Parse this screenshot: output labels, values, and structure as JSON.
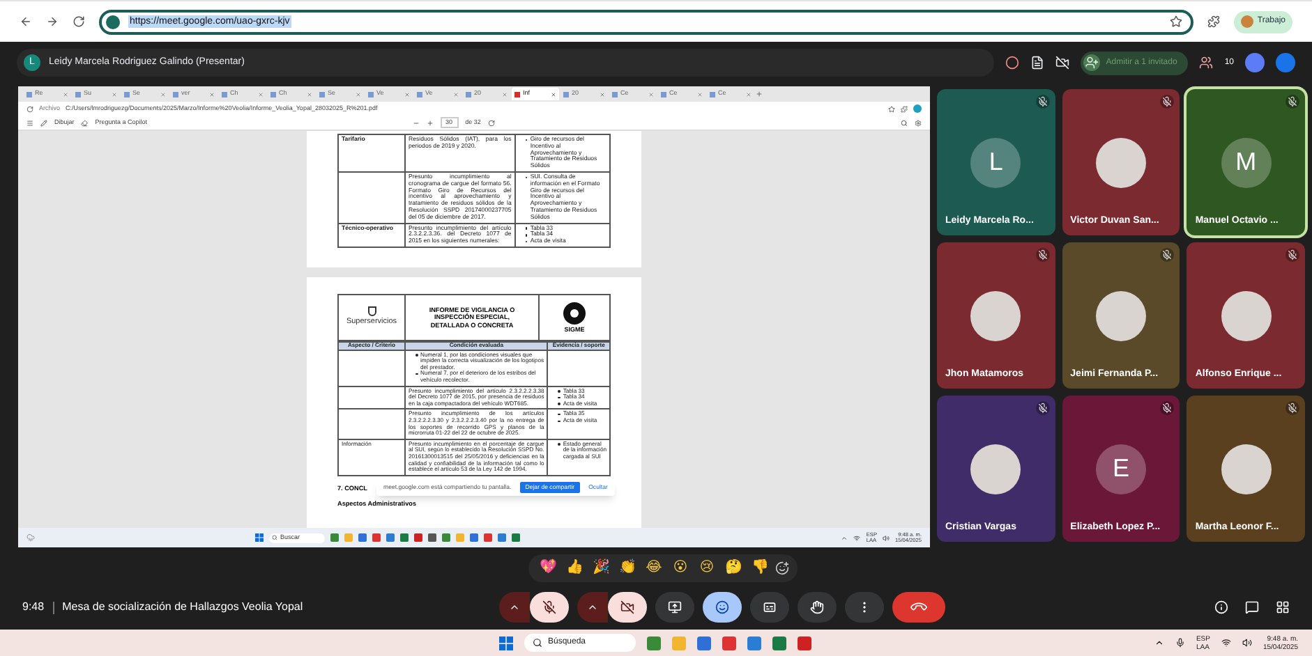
{
  "browser": {
    "url": "https://meet.google.com/uao-gxrc-kjv",
    "profile": "Trabajo"
  },
  "meet_header": {
    "presenter_initial": "L",
    "presenter": "Leidy Marcela Rodriguez Galindo (Presentar)",
    "admit_button": "Admitir a 1 invitado",
    "participant_count": "10"
  },
  "shared_screen": {
    "tabs": [
      {
        "label": "Re",
        "selected": false
      },
      {
        "label": "Su",
        "selected": false
      },
      {
        "label": "Se",
        "selected": false
      },
      {
        "label": "ver",
        "selected": false
      },
      {
        "label": "Ch",
        "selected": false
      },
      {
        "label": "Ch",
        "selected": false
      },
      {
        "label": "Se",
        "selected": false
      },
      {
        "label": "Ve",
        "selected": false
      },
      {
        "label": "Ve",
        "selected": false
      },
      {
        "label": "20",
        "selected": false
      },
      {
        "label": "Inf",
        "selected": true
      },
      {
        "label": "20",
        "selected": false
      },
      {
        "label": "Ce",
        "selected": false
      },
      {
        "label": "Ce",
        "selected": false
      },
      {
        "label": "Ce",
        "selected": false
      }
    ],
    "file_label": "Archivo",
    "path": "C:/Users/lmrodriguezg/Documents/2025/Marzo/Informe%20Veolia/Informe_Veolia_Yopal_28032025_R%201.pdf",
    "toolbar": {
      "draw": "Dibujar",
      "copilot": "Pregunta a Copilot",
      "page": "30",
      "page_total": "de 32"
    },
    "page_one_rows": [
      {
        "aspect": "Tarifario",
        "condition": "Residuos Sólidos (IAT), para los periodos de 2019 y 2020.",
        "evidence": [
          "Giro de recursos del Incentivo al Aprovechamiento y Tratamiento de Residuos Sólidos"
        ]
      },
      {
        "aspect": "",
        "condition": "Presunto incumplimiento al cronograma de cargue del formato 56. Formato Giro de Recursos del incentivo al aprovechamiento y tratamiento de residuos sólidos de la Resolución SSPD 20174000237705 del 05 de diciembre de 2017.",
        "evidence": [
          "SUI. Consulta de información en el Formato Giro de recursos del Incentivo al Aprovechamiento y Tratamiento de Residuos Sólidos"
        ]
      },
      {
        "aspect": "Técnico-operativo",
        "condition": "Presunto incumplimiento del artículo 2.3.2.2.3.36. del Decreto 1077 de 2015 en los siguientes numerales:",
        "evidence": [
          "Tabla 33",
          "Tabla 34",
          "Acta de visita"
        ]
      }
    ],
    "page_two": {
      "logo_text": "Superservicios",
      "report_title": "INFORME DE VIGILANCIA O INSPECCIÓN ESPECIAL, DETALLADA O CONCRETA",
      "seal_text": "SIGME",
      "columns": [
        "Aspecto / Criterio",
        "Condición evaluada",
        "Evidencia / soporte"
      ],
      "rows": [
        {
          "aspect": "",
          "condition_bullets": [
            "Numeral 1, por las condiciones visuales que impiden la correcta visualización de los logotipos del prestador.",
            "Numeral 7, por el deterioro de los estribos del vehículo recolector."
          ],
          "evidence": []
        },
        {
          "aspect": "",
          "condition": "Presunto incumplimiento del artículo 2.3.2.2.2.3.38 del Decreto 1077 de 2015, por presencia de residuos en la caja compactadora del vehículo WDT685.",
          "evidence": [
            "Tabla 33",
            "Tabla 34",
            "Acta de visita"
          ]
        },
        {
          "aspect": "",
          "condition": "Presunto incumplimiento de los artículos 2.3.2.2.2.3.30 y 2.3.2.2.2.3.40 por la no entrega de los soportes de recorrido GPS y planos de la microrruta 01-22 del 22 de octubre de 2025.",
          "evidence": [
            "Tabla 35",
            "Acta de visita"
          ]
        },
        {
          "aspect": "Información",
          "condition": "Presunto incumplimiento en el porcentaje de cargue al SUI, según lo establecido la Resolución SSPD No. 20161300013515 del 25/05/2016 y deficiencias en la calidad y confiabilidad de la información tal como lo establece el artículo 53 de la Ley 142 de 1994.",
          "evidence": [
            "Estado general de la información cargada al SUI"
          ]
        }
      ],
      "section_heading": "7. CONCL",
      "subheading": "Aspectos Administrativos"
    },
    "share_notice": {
      "text": "meet.google.com está compartiendo tu pantalla.",
      "stop_button": "Dejar de compartir",
      "hide_button": "Ocultar"
    },
    "taskbar": {
      "search": "Buscar",
      "lang": "ESP",
      "region": "LAA",
      "time": "9:48 a. m.",
      "date": "15/04/2025"
    }
  },
  "participants": [
    {
      "name": "Leidy Marcela Ro...",
      "kind": "initial",
      "initial": "L",
      "color": "#1d5a52",
      "speaking": false
    },
    {
      "name": "Victor Duvan San...",
      "kind": "photo",
      "color": "#7b2a30",
      "speaking": false
    },
    {
      "name": "Manuel Octavio ...",
      "kind": "initial",
      "initial": "M",
      "color": "#2e5722",
      "speaking": true
    },
    {
      "name": "Jhon Matamoros",
      "kind": "photo",
      "color": "#7b2a30",
      "speaking": false
    },
    {
      "name": "Jeimi Fernanda P...",
      "kind": "photo",
      "color": "#5a4a2a",
      "speaking": false
    },
    {
      "name": "Alfonso Enrique ...",
      "kind": "photo",
      "color": "#7b2a30",
      "speaking": false
    },
    {
      "name": "Cristian Vargas",
      "kind": "photo",
      "color": "#3f2c68",
      "speaking": false
    },
    {
      "name": "Elizabeth Lopez P...",
      "kind": "initial",
      "initial": "E",
      "color": "#6b1838",
      "speaking": false
    },
    {
      "name": "Martha Leonor F...",
      "kind": "photo",
      "color": "#5b4020",
      "speaking": false
    }
  ],
  "reactions": [
    "💖",
    "👍",
    "🎉",
    "👏",
    "😂",
    "😮",
    "😢",
    "🤔",
    "👎"
  ],
  "meeting": {
    "time": "9:48",
    "title": "Mesa de socialización de Hallazgos Veolia Yopal"
  },
  "controls": [
    {
      "kind": "mic",
      "on": false
    },
    {
      "kind": "camera",
      "on": false
    },
    {
      "kind": "present",
      "on": false
    },
    {
      "kind": "reactions",
      "on": true
    },
    {
      "kind": "captions",
      "on": false
    },
    {
      "kind": "hand",
      "on": false
    },
    {
      "kind": "more"
    },
    {
      "kind": "leave"
    }
  ],
  "windows_taskbar": {
    "search": "Búsqueda",
    "lang": "ESP",
    "region": "LAA",
    "time": "9:48 a. m.",
    "date": "15/04/2025"
  }
}
